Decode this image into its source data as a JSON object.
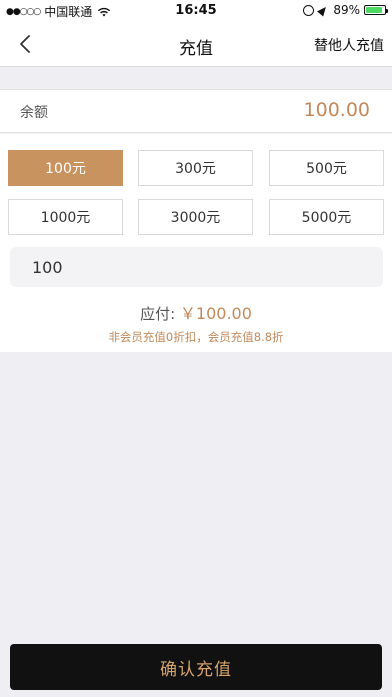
{
  "status_bar": {
    "carrier": "中国联通",
    "time": "16:45",
    "battery_percent": "89%",
    "battery_level": 0.89
  },
  "nav": {
    "title": "充值",
    "right_action": "替他人充值"
  },
  "balance": {
    "label": "余额",
    "value": "100.00"
  },
  "amounts": {
    "options": [
      {
        "label": "100元",
        "selected": true
      },
      {
        "label": "300元",
        "selected": false
      },
      {
        "label": "500元",
        "selected": false
      },
      {
        "label": "1000元",
        "selected": false
      },
      {
        "label": "3000元",
        "selected": false
      },
      {
        "label": "5000元",
        "selected": false
      }
    ],
    "custom_value": "100"
  },
  "payment": {
    "label": "应付:",
    "value": "￥100.00",
    "note": "非会员充值0折扣，会员充值8.8折"
  },
  "confirm_label": "确认充值",
  "colors": {
    "accent": "#c4895a",
    "selected_bg": "#c9935f",
    "confirm_bg": "#111111",
    "confirm_text": "#d4a46c",
    "page_bg": "#efeef3"
  }
}
